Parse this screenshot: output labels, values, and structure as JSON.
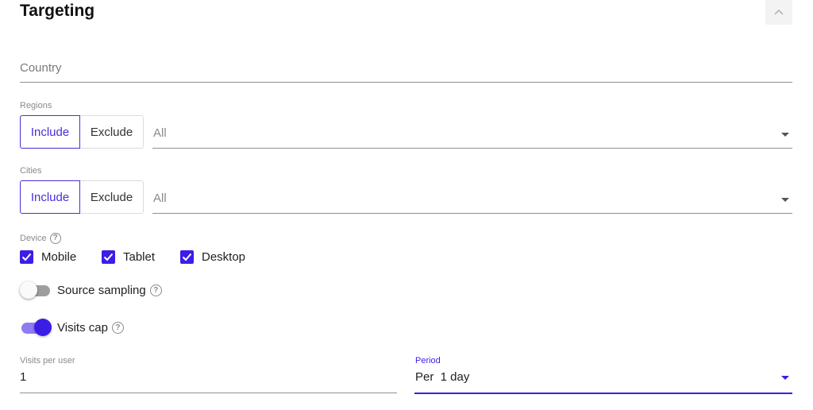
{
  "section": {
    "title": "Targeting",
    "collapse_icon": "chevron-up-icon"
  },
  "country": {
    "placeholder": "Country"
  },
  "regions": {
    "label": "Regions",
    "include_label": "Include",
    "exclude_label": "Exclude",
    "selected_mode": "Include",
    "value": "All"
  },
  "cities": {
    "label": "Cities",
    "include_label": "Include",
    "exclude_label": "Exclude",
    "selected_mode": "Include",
    "value": "All"
  },
  "device": {
    "label": "Device",
    "options": [
      {
        "label": "Mobile",
        "checked": true
      },
      {
        "label": "Tablet",
        "checked": true
      },
      {
        "label": "Desktop",
        "checked": true
      }
    ]
  },
  "source_sampling": {
    "label": "Source sampling",
    "enabled": false
  },
  "visits_cap": {
    "label": "Visits cap",
    "enabled": true
  },
  "visits_per_user": {
    "label": "Visits per user",
    "value": "1"
  },
  "period": {
    "label": "Period",
    "value": "Per  1 day"
  },
  "colors": {
    "accent": "#3b1ee6",
    "accent_light": "#8f7cf2",
    "text": "#212121",
    "muted": "#8a8a8a"
  }
}
